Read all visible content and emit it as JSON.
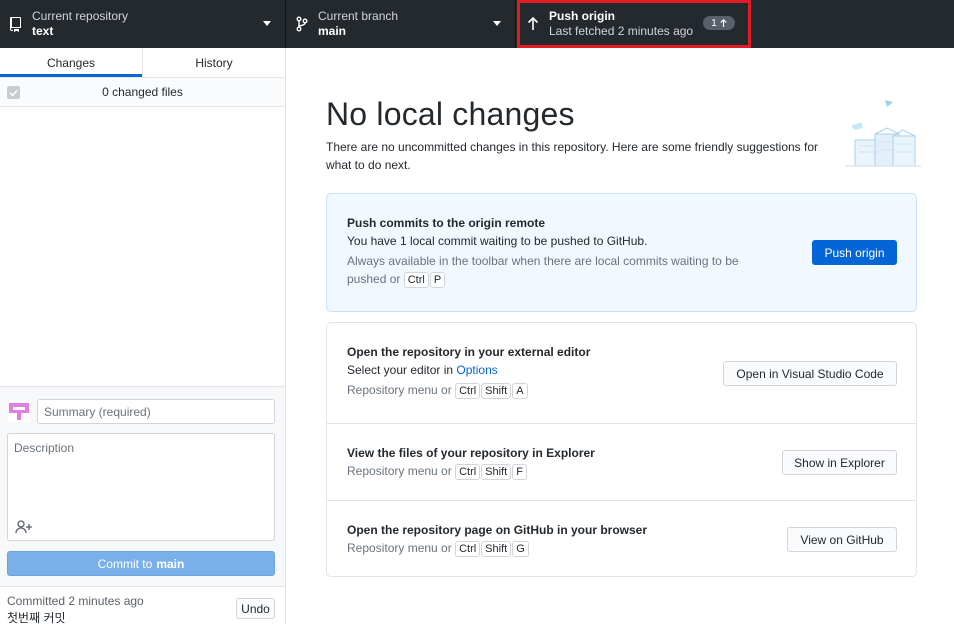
{
  "toolbar": {
    "repository": {
      "label": "Current repository",
      "value": "text",
      "icon": "repo-icon"
    },
    "branch": {
      "label": "Current branch",
      "value": "main",
      "icon": "branch-icon"
    },
    "push": {
      "label": "Push origin",
      "sublabel": "Last fetched 2 minutes ago",
      "badge_count": "1",
      "icon": "arrow-up-icon"
    }
  },
  "sidebar": {
    "tabs": [
      {
        "label": "Changes",
        "active": true
      },
      {
        "label": "History",
        "active": false
      }
    ],
    "changed_files_label": "0 changed files",
    "commit": {
      "summary_placeholder": "Summary (required)",
      "description_placeholder": "Description",
      "button_prefix": "Commit to",
      "button_branch": "main"
    },
    "last_commit": {
      "time": "Committed 2 minutes ago",
      "message": "첫번째 커밋",
      "undo_label": "Undo"
    }
  },
  "main": {
    "title": "No local changes",
    "subtitle": "There are no uncommitted changes in this repository. Here are some friendly suggestions for what to do next.",
    "push_card": {
      "title": "Push commits to the origin remote",
      "desc": "You have 1 local commit waiting to be pushed to GitHub.",
      "hint": "Always available in the toolbar when there are local commits waiting to be pushed or",
      "keys": [
        "Ctrl",
        "P"
      ],
      "button": "Push origin"
    },
    "editor_row": {
      "title": "Open the repository in your external editor",
      "desc_prefix": "Select your editor in",
      "desc_link": "Options",
      "hint": "Repository menu or",
      "keys": [
        "Ctrl",
        "Shift",
        "A"
      ],
      "button": "Open in Visual Studio Code"
    },
    "explorer_row": {
      "title": "View the files of your repository in Explorer",
      "hint": "Repository menu or",
      "keys": [
        "Ctrl",
        "Shift",
        "F"
      ],
      "button": "Show in Explorer"
    },
    "github_row": {
      "title": "Open the repository page on GitHub in your browser",
      "hint": "Repository menu or",
      "keys": [
        "Ctrl",
        "Shift",
        "G"
      ],
      "button": "View on GitHub"
    }
  },
  "colors": {
    "toolbar_bg": "#24292e",
    "accent": "#0366d6",
    "highlight_outline": "#e01b24",
    "commit_button": "#79b0ea"
  }
}
